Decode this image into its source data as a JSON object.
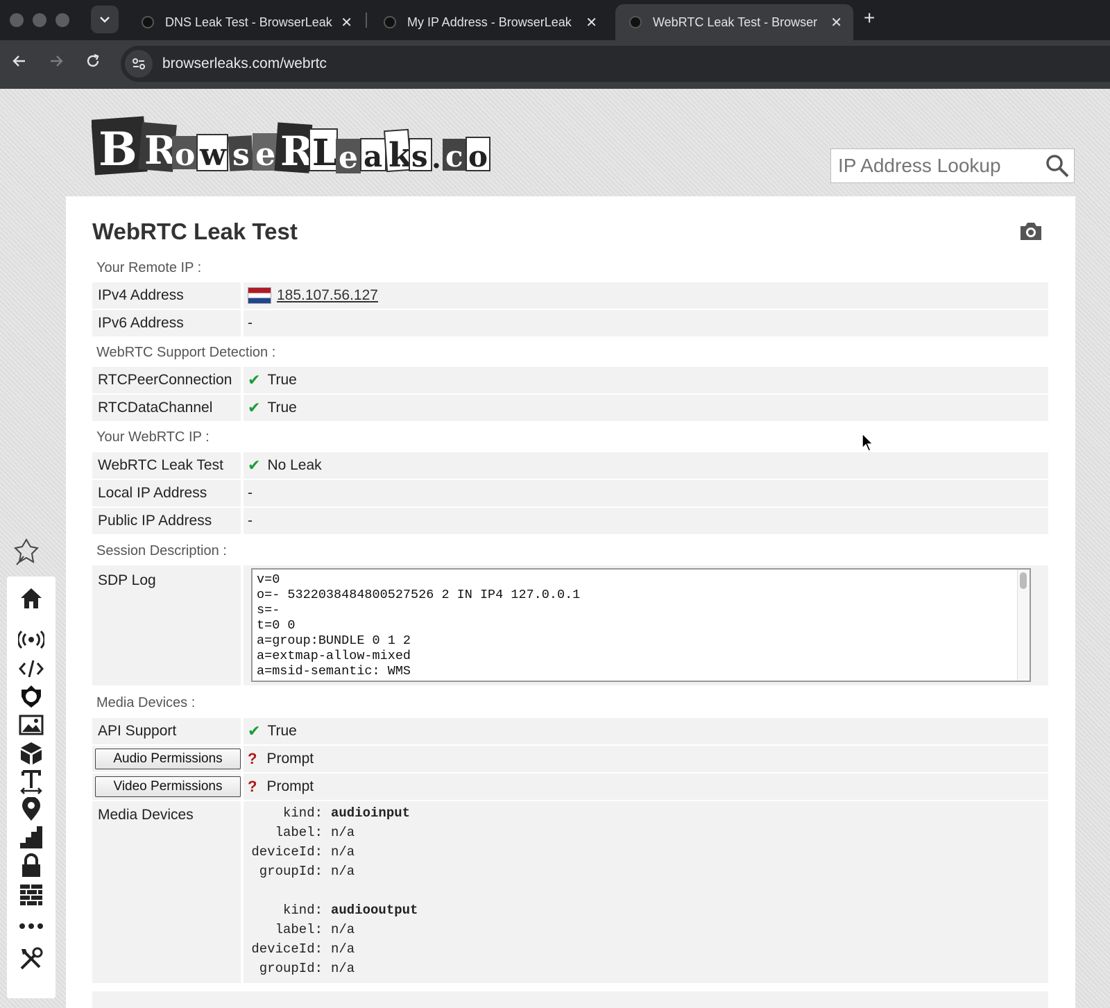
{
  "browser": {
    "tabs": [
      {
        "title": "DNS Leak Test - BrowserLeak",
        "active": false
      },
      {
        "title": "My IP Address - BrowserLeak",
        "active": false
      },
      {
        "title": "WebRTC Leak Test - Browser",
        "active": true
      }
    ],
    "url": "browserleaks.com/webrtc",
    "icons": {
      "back": "arrow-left-icon",
      "forward": "arrow-right-icon",
      "reload": "reload-icon",
      "new_tab": "plus-icon",
      "close": "close-icon"
    }
  },
  "site": {
    "logo_text": "BrowserLeaks.com",
    "search_placeholder": "IP Address Lookup"
  },
  "main": {
    "title": "WebRTC Leak Test",
    "sections": {
      "remote_ip": "Your Remote IP :",
      "support": "WebRTC Support Detection :",
      "webrtc_ip": "Your WebRTC IP :",
      "session": "Session Description :",
      "media": "Media Devices :"
    },
    "rows": {
      "ipv4": {
        "key": "IPv4 Address",
        "value": "185.107.56.127",
        "flag": "netherlands-flag"
      },
      "ipv6": {
        "key": "IPv6 Address",
        "value": "-"
      },
      "rtc_peer": {
        "key": "RTCPeerConnection",
        "value": "True"
      },
      "rtc_data": {
        "key": "RTCDataChannel",
        "value": "True"
      },
      "leak_test": {
        "key": "WebRTC Leak Test",
        "value": "No Leak"
      },
      "local_ip": {
        "key": "Local IP Address",
        "value": "-"
      },
      "public_ip": {
        "key": "Public IP Address",
        "value": "-"
      },
      "sdp": {
        "key": "SDP Log",
        "value": "v=0\no=- 5322038484800527526 2 IN IP4 127.0.0.1\ns=-\nt=0 0\na=group:BUNDLE 0 1 2\na=extmap-allow-mixed\na=msid-semantic: WMS"
      },
      "api_support": {
        "key": "API Support",
        "value": "True"
      },
      "audio_perm": {
        "key": "Audio Permissions",
        "value": "Prompt"
      },
      "video_perm": {
        "key": "Video Permissions",
        "value": "Prompt"
      },
      "media_devices": {
        "key": "Media Devices"
      }
    },
    "status_marks": {
      "check": "✔",
      "question": "?"
    },
    "devices": [
      {
        "kind_label": "kind:",
        "kind": "audioinput",
        "label_label": "label:",
        "label": "n/a",
        "deviceId_label": "deviceId:",
        "deviceId": "n/a",
        "groupId_label": "groupId:",
        "groupId": "n/a"
      },
      {
        "kind_label": "kind:",
        "kind": "audiooutput",
        "label_label": "label:",
        "label": "n/a",
        "deviceId_label": "deviceId:",
        "deviceId": "n/a",
        "groupId_label": "groupId:",
        "groupId": "n/a"
      }
    ]
  },
  "sidebar": {
    "icons": [
      "pin-icon",
      "home-icon",
      "broadcast-icon",
      "code-icon",
      "fingerprint-icon",
      "image-icon",
      "cube-icon",
      "font-icon",
      "location-icon",
      "stairs-icon",
      "lock-icon",
      "firewall-icon",
      "more-icon",
      "tools-icon"
    ]
  }
}
